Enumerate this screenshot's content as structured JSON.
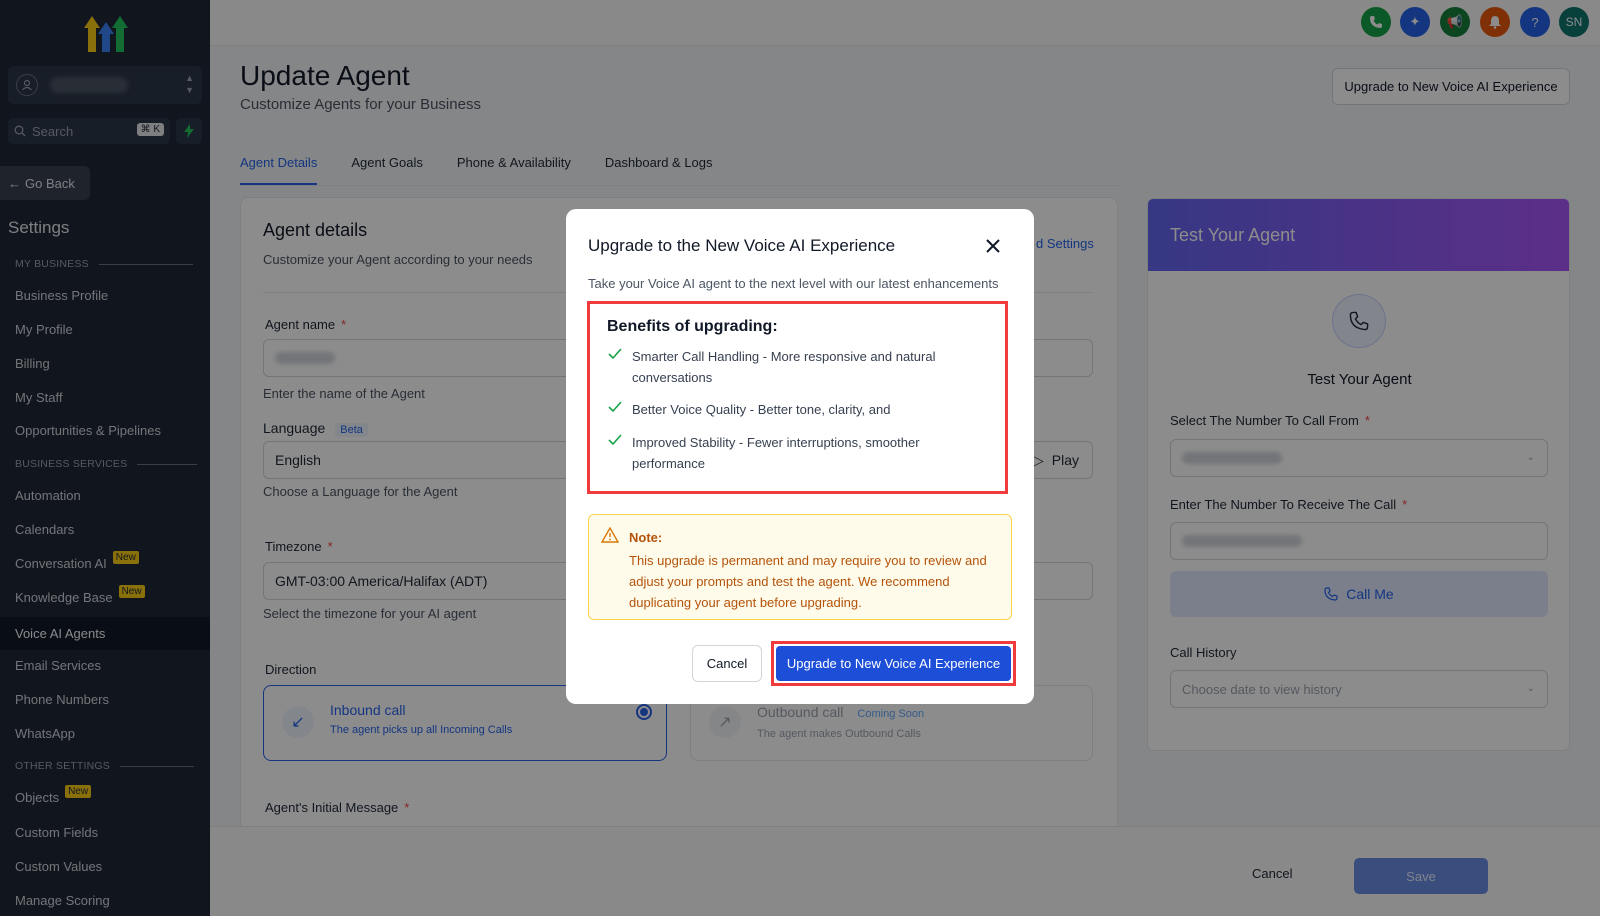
{
  "sidebar": {
    "search_placeholder": "Search",
    "search_shortcut": "⌘ K",
    "go_back": "Go Back",
    "settings_title": "Settings",
    "sections": {
      "my_business": "MY BUSINESS",
      "business_services": "BUSINESS SERVICES",
      "other_settings": "OTHER SETTINGS"
    },
    "items": {
      "business_profile": "Business Profile",
      "my_profile": "My Profile",
      "billing": "Billing",
      "my_staff": "My Staff",
      "opportunities": "Opportunities & Pipelines",
      "automation": "Automation",
      "calendars": "Calendars",
      "conversation_ai": "Conversation AI",
      "knowledge_base": "Knowledge Base",
      "voice_ai_agents": "Voice AI Agents",
      "email_services": "Email Services",
      "phone_numbers": "Phone Numbers",
      "whatsapp": "WhatsApp",
      "objects": "Objects",
      "custom_fields": "Custom Fields",
      "custom_values": "Custom Values",
      "manage_scoring": "Manage Scoring"
    },
    "new_badge": "New"
  },
  "topbar": {
    "avatar_initials": "SN",
    "help": "?",
    "colors": {
      "phone": "#16a34a",
      "sparkle": "#2563eb",
      "megaphone": "#15803d",
      "bell": "#ea580c",
      "help": "#2563eb",
      "avatar": "#0f766e"
    }
  },
  "header": {
    "title": "Update Agent",
    "subtitle": "Customize Agents for your Business",
    "upgrade_button": "Upgrade to New Voice AI Experience"
  },
  "tabs": [
    "Agent Details",
    "Agent Goals",
    "Phone & Availability",
    "Dashboard & Logs"
  ],
  "agent_details": {
    "title": "Agent details",
    "subtitle": "Customize your Agent according to your needs",
    "settings_link": "d Settings",
    "agent_name_label": "Agent name",
    "agent_name_hint": "Enter the name of the Agent",
    "language_label": "Language",
    "beta": "Beta",
    "language_value": "English",
    "play": "Play",
    "language_hint": "Choose a Language for the Agent",
    "timezone_label": "Timezone",
    "timezone_value": "GMT-03:00 America/Halifax (ADT)",
    "timezone_hint": "Select the timezone for your AI agent",
    "direction_label": "Direction",
    "inbound_title": "Inbound call",
    "inbound_sub": "The agent picks up all Incoming Calls",
    "outbound_title": "Outbound call",
    "coming_soon": "Coming Soon",
    "outbound_sub": "The agent makes Outbound Calls",
    "initial_message_label": "Agent's Initial Message"
  },
  "footer": {
    "cancel": "Cancel",
    "save": "Save"
  },
  "test_panel": {
    "header": "Test Your Agent",
    "title": "Test Your Agent",
    "from_label": "Select The Number To Call From",
    "to_label": "Enter The Number To Receive The Call",
    "call_me": "Call Me",
    "history_label": "Call History",
    "history_placeholder": "Choose date to view history"
  },
  "modal": {
    "title": "Upgrade to the New Voice AI Experience",
    "subtitle": "Take your Voice AI agent to the next level with our latest enhancements",
    "benefits_title": "Benefits of upgrading:",
    "benefits": [
      "Smarter Call Handling - More responsive and natural conversations",
      "Better Voice Quality - Better tone, clarity, and",
      "Improved Stability - Fewer interruptions, smoother performance"
    ],
    "note_title": "Note:",
    "note_text": "This upgrade is permanent and may require you to review and adjust your prompts and test the agent. We recommend duplicating your agent before upgrading.",
    "cancel": "Cancel",
    "upgrade": "Upgrade to New Voice AI Experience"
  }
}
